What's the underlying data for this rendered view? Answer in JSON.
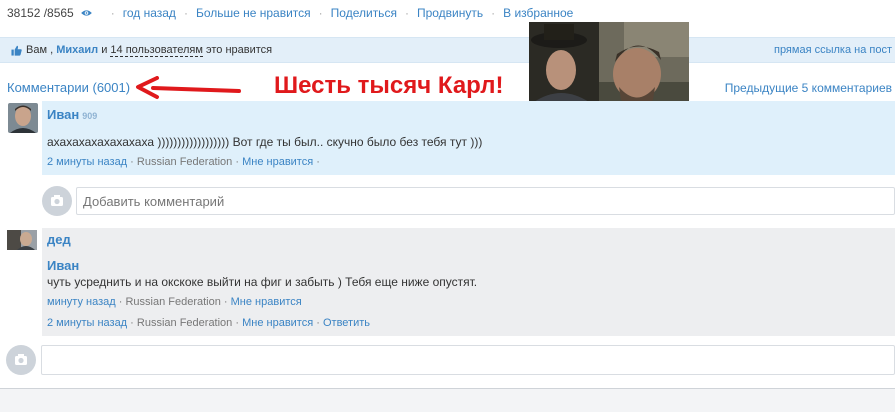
{
  "topbar": {
    "stats": "38152 /8565",
    "links": [
      "год назад",
      "Больше не нравится",
      "Поделиться",
      "Продвинуть",
      "В избранное"
    ]
  },
  "likes": {
    "prefix": "Вам ,",
    "user": "Михаил",
    "and": "и",
    "count_users": "14 пользователям",
    "suffix": "это нравится",
    "direct_link": "прямая ссылка на пост"
  },
  "comments": {
    "header": "Комментарии (6001)",
    "prev_link": "Предыдущие 5 комментариев"
  },
  "overlay_caption": "Шесть тысяч Карл!",
  "comment1": {
    "author": "Иван",
    "rating": "909",
    "text": "ахахахахахахахаха )))))))))))))))))) Вот где ты был.. скучно было без тебя тут )))",
    "time": "2 минуты назад",
    "location": "Russian Federation",
    "like": "Мне нравится",
    "dot": "·"
  },
  "add_comment": {
    "placeholder": "Добавить комментарий"
  },
  "comment2": {
    "author": "дед",
    "reply_to": "Иван",
    "text": "чуть усреднить и на окскоке выйти на фиг и забыть ) Тебя еще ниже опустят.",
    "quoted_time": "минуту назад",
    "quoted_location": "Russian Federation",
    "quoted_like": "Мне нравится",
    "time": "2 минуты назад",
    "location": "Russian Federation",
    "like": "Мне нравится",
    "reply": "Ответить",
    "dot": "·"
  },
  "colors": {
    "link": "#3b84c4",
    "caption": "#e0191c",
    "comment_bg": "#dff0fb",
    "comment2_bg": "#edeef0"
  },
  "icons": [
    "eye-icon",
    "thumb-up-icon",
    "arrow-left-icon",
    "camera-icon"
  ]
}
